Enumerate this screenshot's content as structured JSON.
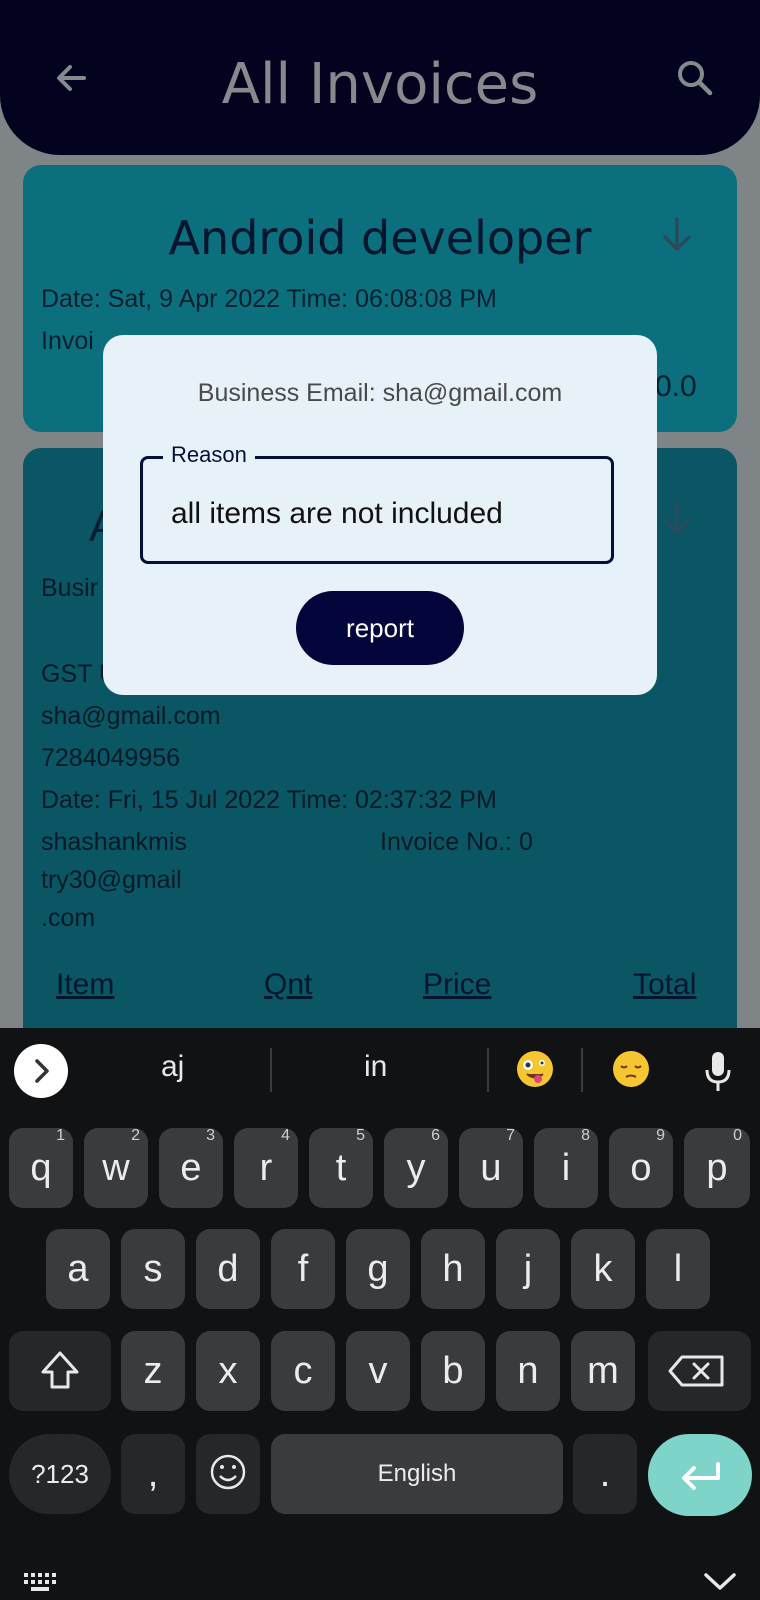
{
  "appbar": {
    "title": "All Invoices"
  },
  "card1": {
    "title": "Android developer",
    "datetime": "Date:  Sat, 9 Apr 2022 Time:  06:08:08 PM",
    "partial_label": "Invoi",
    "partial_total": "0.0"
  },
  "card2": {
    "partial_title": "A",
    "partial_business": "Busir",
    "partial_gst": "GST U",
    "email": "sha@gmail.com",
    "phone": "7284049956",
    "datetime": "Date:  Fri, 15 Jul 2022 Time:  02:37:32 PM",
    "customer_line1": "shashankmis",
    "customer_line2": "try30@gmail",
    "customer_line3": ".com",
    "invoice_no": "Invoice No.: 0",
    "headers": [
      "Item",
      "Qnt",
      "Price",
      "Total"
    ]
  },
  "dialog": {
    "business_email": "Business Email: sha@gmail.com",
    "reason_label": "Reason",
    "reason_value": "all items are not included",
    "report_label": "report"
  },
  "keyboard": {
    "suggestions": [
      "aj",
      "in"
    ],
    "row1": [
      [
        "q",
        "1"
      ],
      [
        "w",
        "2"
      ],
      [
        "e",
        "3"
      ],
      [
        "r",
        "4"
      ],
      [
        "t",
        "5"
      ],
      [
        "y",
        "6"
      ],
      [
        "u",
        "7"
      ],
      [
        "i",
        "8"
      ],
      [
        "o",
        "9"
      ],
      [
        "p",
        "0"
      ]
    ],
    "row2": [
      "a",
      "s",
      "d",
      "f",
      "g",
      "h",
      "j",
      "k",
      "l"
    ],
    "row3": [
      "z",
      "x",
      "c",
      "v",
      "b",
      "n",
      "m"
    ],
    "symbols_label": "?123",
    "comma_label": ",",
    "space_label": "English",
    "period_label": "."
  }
}
